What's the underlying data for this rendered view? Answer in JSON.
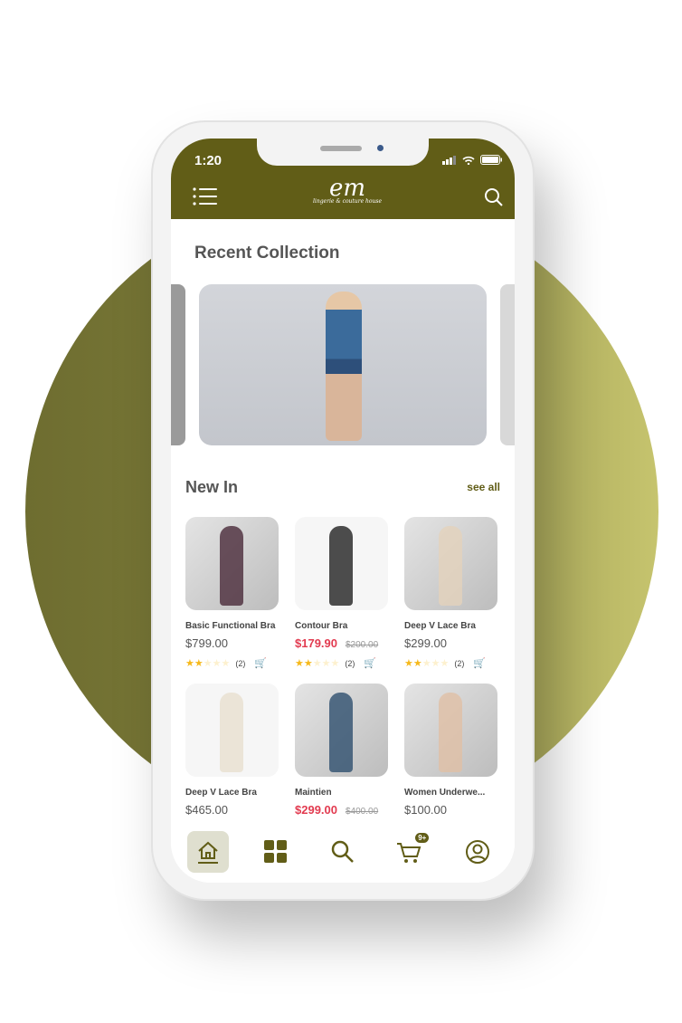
{
  "status_bar": {
    "time": "1:20"
  },
  "header": {
    "logo_text": "em",
    "logo_tagline": "lingerie & couture house"
  },
  "colors": {
    "brand": "#615d17",
    "sale": "#e23b50",
    "star": "#f6b91b"
  },
  "recent": {
    "title": "Recent Collection"
  },
  "new_in": {
    "title": "New In",
    "see_all": "see all"
  },
  "products": [
    {
      "name": "Basic Functional Bra",
      "price": "$799.00",
      "old_price": "",
      "rating": 2,
      "reviews": "(2)"
    },
    {
      "name": "Contour Bra",
      "price": "$179.90",
      "old_price": "$200.00",
      "rating": 2,
      "reviews": "(2)"
    },
    {
      "name": "Deep V Lace Bra",
      "price": "$299.00",
      "old_price": "",
      "rating": 2,
      "reviews": "(2)"
    },
    {
      "name": "Deep V Lace Bra",
      "price": "$465.00",
      "old_price": ""
    },
    {
      "name": "Maintien",
      "price": "$299.00",
      "old_price": "$400.00"
    },
    {
      "name": "Women Underwe...",
      "price": "$100.00",
      "old_price": ""
    }
  ],
  "nav": {
    "items": [
      "home",
      "categories",
      "search",
      "cart",
      "profile"
    ],
    "active": "home",
    "cart_badge": "9+"
  }
}
